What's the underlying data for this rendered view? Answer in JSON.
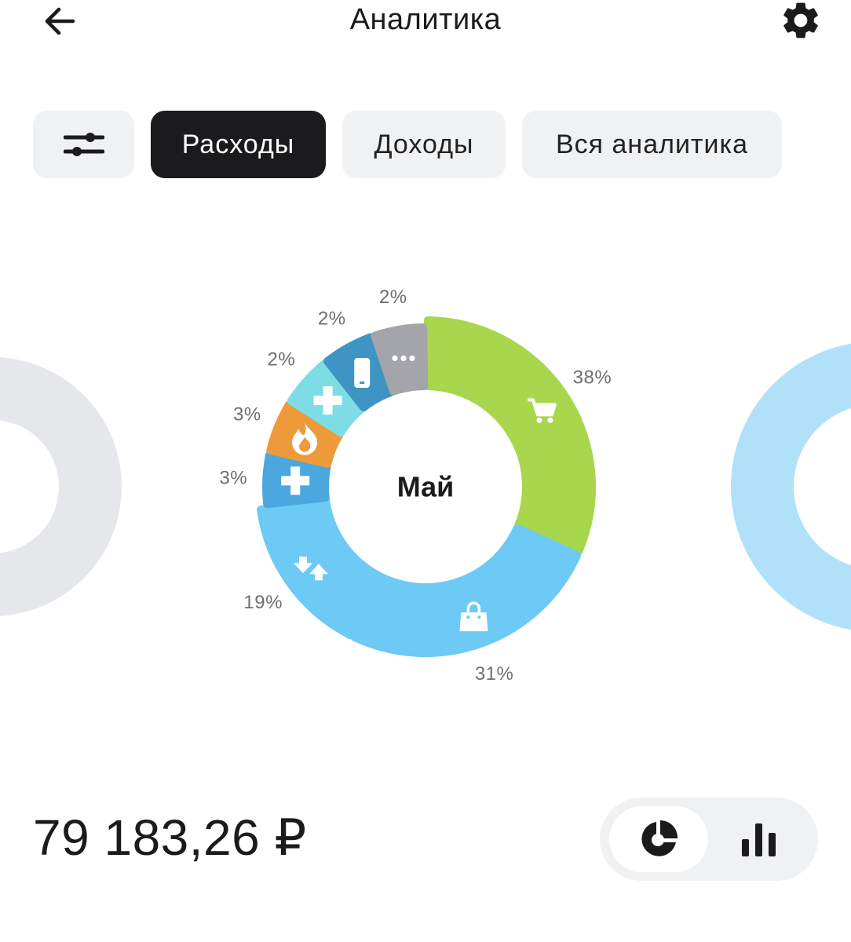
{
  "header": {
    "title": "Аналитика"
  },
  "tabs": [
    {
      "label": "Расходы",
      "active": true
    },
    {
      "label": "Доходы",
      "active": false
    },
    {
      "label": "Вся аналитика",
      "active": false
    }
  ],
  "chart": {
    "center_label": "Май",
    "segments": [
      {
        "category_icon": "cart-icon",
        "percent": 38,
        "label": "38%",
        "color": "#a8d64c"
      },
      {
        "category_icon": "shopping-bag-icon",
        "percent": 31,
        "label": "31%",
        "color": "#6ccaf5"
      },
      {
        "category_icon": "transfer-arrows-icon",
        "percent": 19,
        "label": "19%",
        "color": "#6ccaf5"
      },
      {
        "category_icon": "medical-cross-icon",
        "percent": 3,
        "label": "3%",
        "color": "#4aa8df"
      },
      {
        "category_icon": "fire-icon",
        "percent": 3,
        "label": "3%",
        "color": "#ee9a3a"
      },
      {
        "category_icon": "medical-cross-icon",
        "percent": 2,
        "label": "2%",
        "color": "#7ddde4"
      },
      {
        "category_icon": "mobile-phone-icon",
        "percent": 2,
        "label": "2%",
        "color": "#3e95c4"
      },
      {
        "category_icon": "more-dots-icon",
        "percent": 2,
        "label": "2%",
        "color": "#a4a4ab"
      }
    ],
    "prev_month_color": "#e6e7ea",
    "next_month_color": "#b0e1f8"
  },
  "total": "79 183,26 ₽",
  "view_toggle": {
    "selected": "pie"
  }
}
